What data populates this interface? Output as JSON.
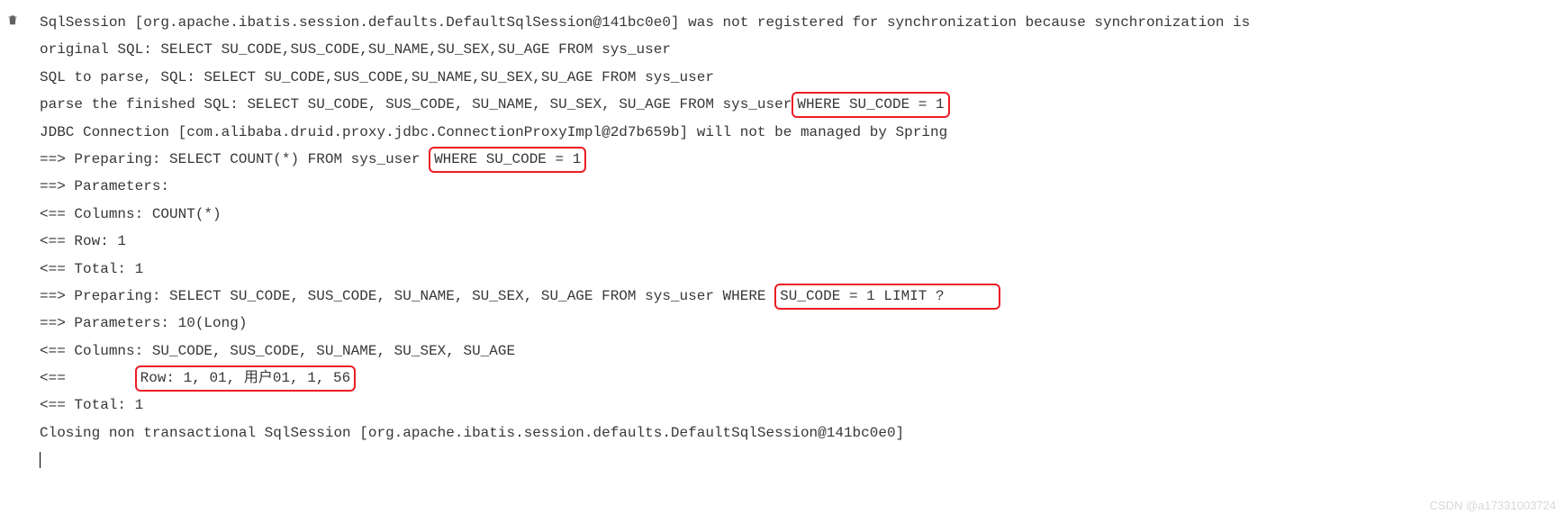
{
  "log": {
    "line1_pre": "SqlSession [org.apache.ibatis.session.defaults.DefaultSqlSession@141bc0e0] was not registered for synchronization because synchronization is",
    "line2": "original SQL: SELECT  SU_CODE,SUS_CODE,SU_NAME,SU_SEX,SU_AGE  FROM sys_user",
    "line3": "SQL to parse, SQL: SELECT  SU_CODE,SUS_CODE,SU_NAME,SU_SEX,SU_AGE  FROM sys_user",
    "line4_pre": "parse the finished SQL: SELECT SU_CODE, SUS_CODE, SU_NAME, SU_SEX, SU_AGE FROM sys_user",
    "line4_hl": " WHERE SU_CODE = 1",
    "line5": "JDBC Connection [com.alibaba.druid.proxy.jdbc.ConnectionProxyImpl@2d7b659b] will not be managed by Spring",
    "line6_pre": "==>  Preparing: SELECT COUNT(*) FROM sys_user ",
    "line6_hl": "WHERE SU_CODE = 1",
    "line7": "==> Parameters: ",
    "line8": "<==    Columns: COUNT(*)",
    "line9": "<==        Row: 1",
    "line10": "<==      Total: 1",
    "line11_pre": "==>  Preparing: SELECT SU_CODE, SUS_CODE, SU_NAME, SU_SEX, SU_AGE FROM sys_user WHERE ",
    "line11_hl": "SU_CODE = 1 LIMIT ?",
    "line12": "==> Parameters: 10(Long)",
    "line13": "<==    Columns: SU_CODE, SUS_CODE, SU_NAME, SU_SEX, SU_AGE",
    "line14_pre": "<==        ",
    "line14_hl": "Row: 1, 01, 用户01, 1, 56",
    "line15": "<==      Total: 1",
    "line16": "Closing non transactional SqlSession [org.apache.ibatis.session.defaults.DefaultSqlSession@141bc0e0]"
  },
  "watermark": "CSDN @a17331003724"
}
